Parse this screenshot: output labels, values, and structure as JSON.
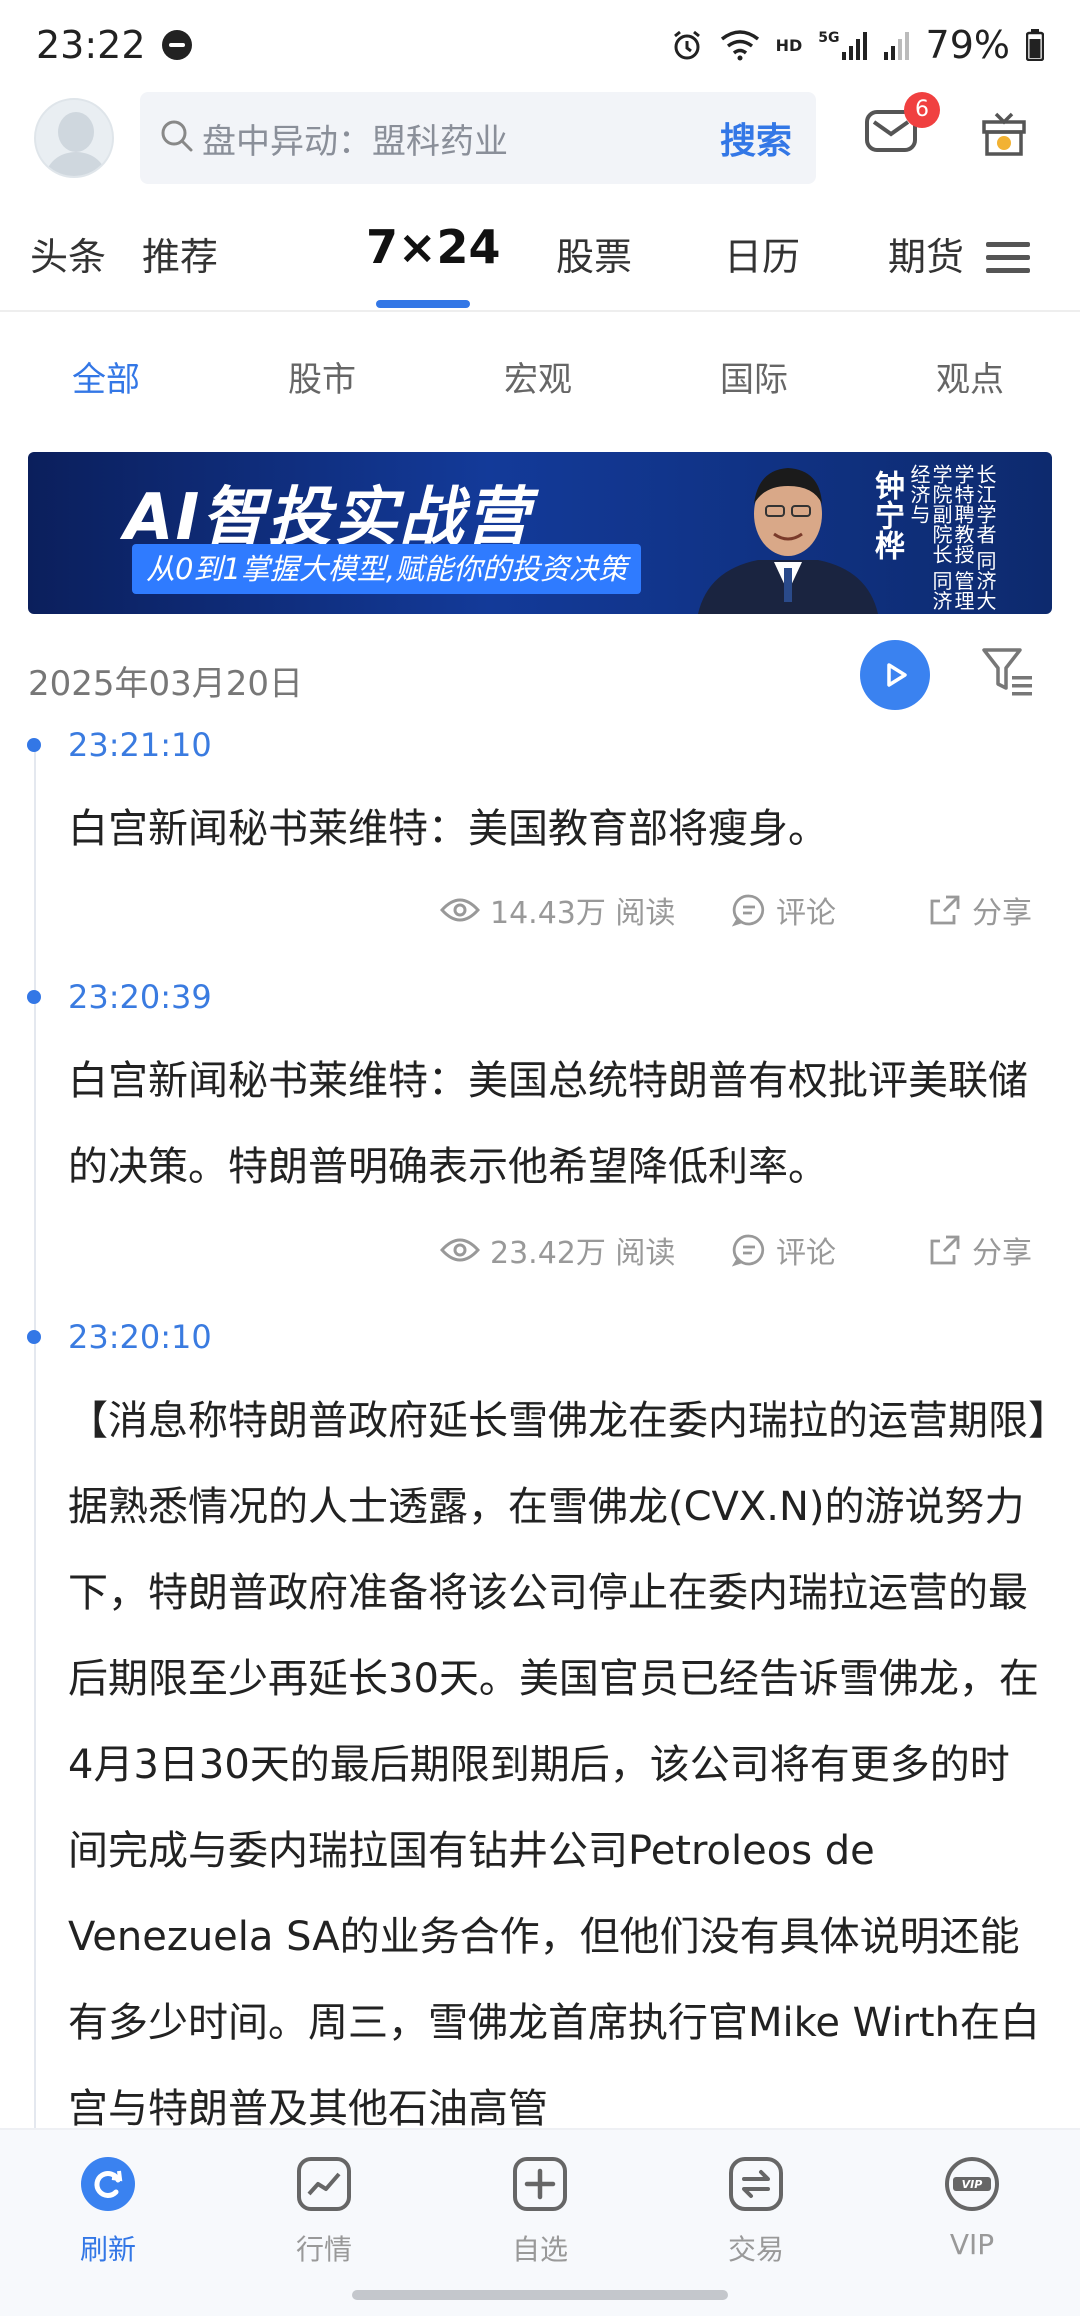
{
  "status_bar": {
    "time": "23:22",
    "net_label": "HD",
    "signal_label": "5G",
    "battery": "79%"
  },
  "header": {
    "search_placeholder": "盘中异动：盟科药业",
    "search_button": "搜索",
    "mail_badge": "6"
  },
  "main_tabs": [
    {
      "label": "头条"
    },
    {
      "label": "推荐"
    },
    {
      "label": "7×24"
    },
    {
      "label": "股票"
    },
    {
      "label": "日历"
    },
    {
      "label": "期货"
    }
  ],
  "sub_tabs": [
    {
      "label": "全部"
    },
    {
      "label": "股市"
    },
    {
      "label": "宏观"
    },
    {
      "label": "国际"
    },
    {
      "label": "观点"
    }
  ],
  "banner": {
    "title": "AI智投实战营",
    "subtitle": "从0到1掌握大模型,赋能你的投资决策",
    "person_name": "钟宁桦",
    "person_titles": "长江学者 同济大学特聘教授 管理学院副院长 同济经济与"
  },
  "feed": {
    "date": "2025年03月20日",
    "items": [
      {
        "time": "23:21:10",
        "text": "白宫新闻秘书莱维特：美国教育部将瘦身。",
        "views": "14.43万 阅读",
        "comment": "评论",
        "share": "分享"
      },
      {
        "time": "23:20:39",
        "text": "白宫新闻秘书莱维特：美国总统特朗普有权批评美联储的决策。特朗普明确表示他希望降低利率。",
        "views": "23.42万 阅读",
        "comment": "评论",
        "share": "分享"
      },
      {
        "time": "23:20:10",
        "text": "【消息称特朗普政府延长雪佛龙在委内瑞拉的运营期限】据熟悉情况的人士透露，在雪佛龙(CVX.N)的游说努力下，特朗普政府准备将该公司停止在委内瑞拉运营的最后期限至少再延长30天。美国官员已经告诉雪佛龙，在4月3日30天的最后期限到期后，该公司将有更多的时间完成与委内瑞拉国有钻井公司Petroleos de Venezuela SA的业务合作，但他们没有具体说明还能有多少时间。周三，雪佛龙首席执行官Mike Wirth在白宫与特朗普及其他石油高管"
      }
    ]
  },
  "bottom_nav": [
    {
      "label": "刷新"
    },
    {
      "label": "行情"
    },
    {
      "label": "自选"
    },
    {
      "label": "交易"
    },
    {
      "label": "VIP"
    }
  ],
  "colors": {
    "accent": "#3377e6",
    "badge": "#f04040",
    "banner_bg": "#133a99"
  }
}
